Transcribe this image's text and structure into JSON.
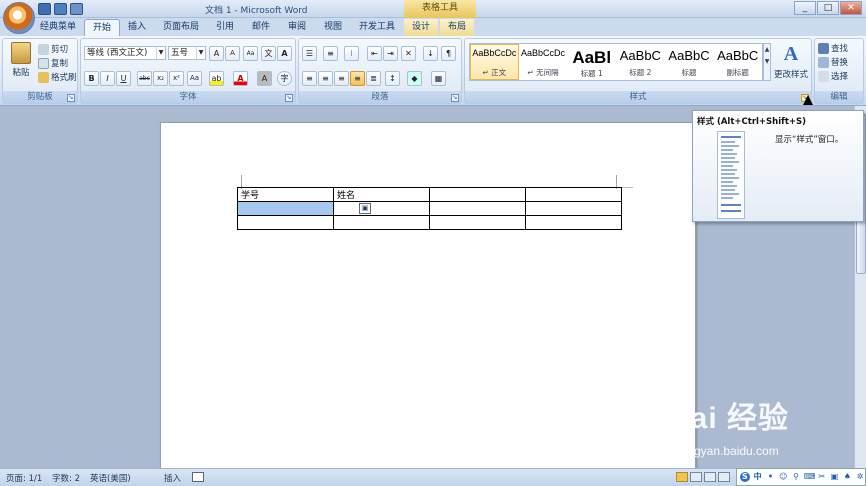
{
  "window": {
    "title": "文档 1 - Microsoft Word",
    "context_tab_group": "表格工具",
    "controls": [
      "_",
      "□",
      "✕"
    ]
  },
  "tabs": [
    {
      "label": "经典菜单"
    },
    {
      "label": "开始",
      "active": true
    },
    {
      "label": "插入"
    },
    {
      "label": "页面布局"
    },
    {
      "label": "引用"
    },
    {
      "label": "邮件"
    },
    {
      "label": "审阅"
    },
    {
      "label": "视图"
    },
    {
      "label": "开发工具"
    },
    {
      "label": "设计"
    },
    {
      "label": "布局"
    }
  ],
  "clipboard": {
    "label": "剪贴板",
    "paste": "粘贴",
    "cut": "剪切",
    "copy": "复制",
    "format_painter": "格式刷"
  },
  "font": {
    "label": "字体",
    "font_name": "等线 (西文正文)",
    "font_size": "五号",
    "grow": "A",
    "shrink": "A",
    "clear": "Aa",
    "bold": "B",
    "italic": "I",
    "underline": "U",
    "strike": "abc",
    "subscript": "x₂",
    "superscript": "x²",
    "change_case": "Aa",
    "font_color": "A",
    "char_shading": "A",
    "enclose": "字"
  },
  "paragraph": {
    "label": "段落"
  },
  "styles": {
    "label": "样式",
    "items": [
      {
        "preview": "AaBbCcDc",
        "name": "↵ 正文",
        "selected": true
      },
      {
        "preview": "AaBbCcDc",
        "name": "↵ 无间隔"
      },
      {
        "preview": "AaBl",
        "name": "标题 1"
      },
      {
        "preview": "AaBbC",
        "name": "标题 2"
      },
      {
        "preview": "AaBbC",
        "name": "标题"
      },
      {
        "preview": "AaBbC",
        "name": "副标题"
      }
    ],
    "change_styles": "更改样式"
  },
  "editing": {
    "label": "编辑",
    "find": "查找",
    "replace": "替换",
    "select": "选择"
  },
  "table": {
    "rows": [
      [
        "学号",
        "姓名",
        "",
        ""
      ],
      [
        "",
        "",
        "",
        ""
      ],
      [
        "",
        "",
        "",
        ""
      ]
    ]
  },
  "tooltip": {
    "title": "样式 (Alt+Ctrl+Shift+S)",
    "description": "显示“样式”窗口。"
  },
  "status": {
    "page": "页面: 1/1",
    "words": "字数: 2",
    "language": "英语(美国)",
    "mode": "插入"
  },
  "watermark": {
    "brand": "Bai 经验",
    "url": "jingyan.baidu.com"
  },
  "ime": {
    "lang": "中"
  },
  "colors": {
    "accent": "#1e395b",
    "selected_cell": "#a7c9ef",
    "context_tab": "#f0dc93"
  }
}
